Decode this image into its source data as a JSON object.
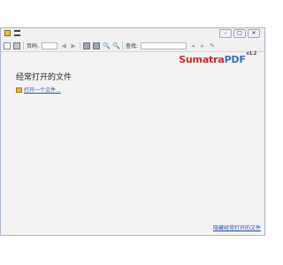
{
  "window": {
    "menu_icons": [
      "sumatra-app-icon",
      "menu-list-icon"
    ],
    "controls": {
      "minimize": "–",
      "maximize": "□",
      "close": "✕"
    }
  },
  "toolbar": {
    "page_label": "页码:",
    "search_label": "查找:",
    "icons": [
      "open-icon",
      "print-icon",
      "prev-page-icon",
      "next-page-icon",
      "fit-page-icon",
      "fit-width-icon",
      "zoom-out-icon",
      "zoom-in-icon",
      "find-prev-icon",
      "find-next-icon",
      "match-case-icon"
    ]
  },
  "brand": {
    "name_part1": "Sumatra",
    "name_part2": "PDF",
    "version": "v1.2"
  },
  "main": {
    "headline": "经常打开的文件",
    "open_document": "打开一个文件..."
  },
  "footer": {
    "hide_link": "隐藏经常打开的文件"
  }
}
